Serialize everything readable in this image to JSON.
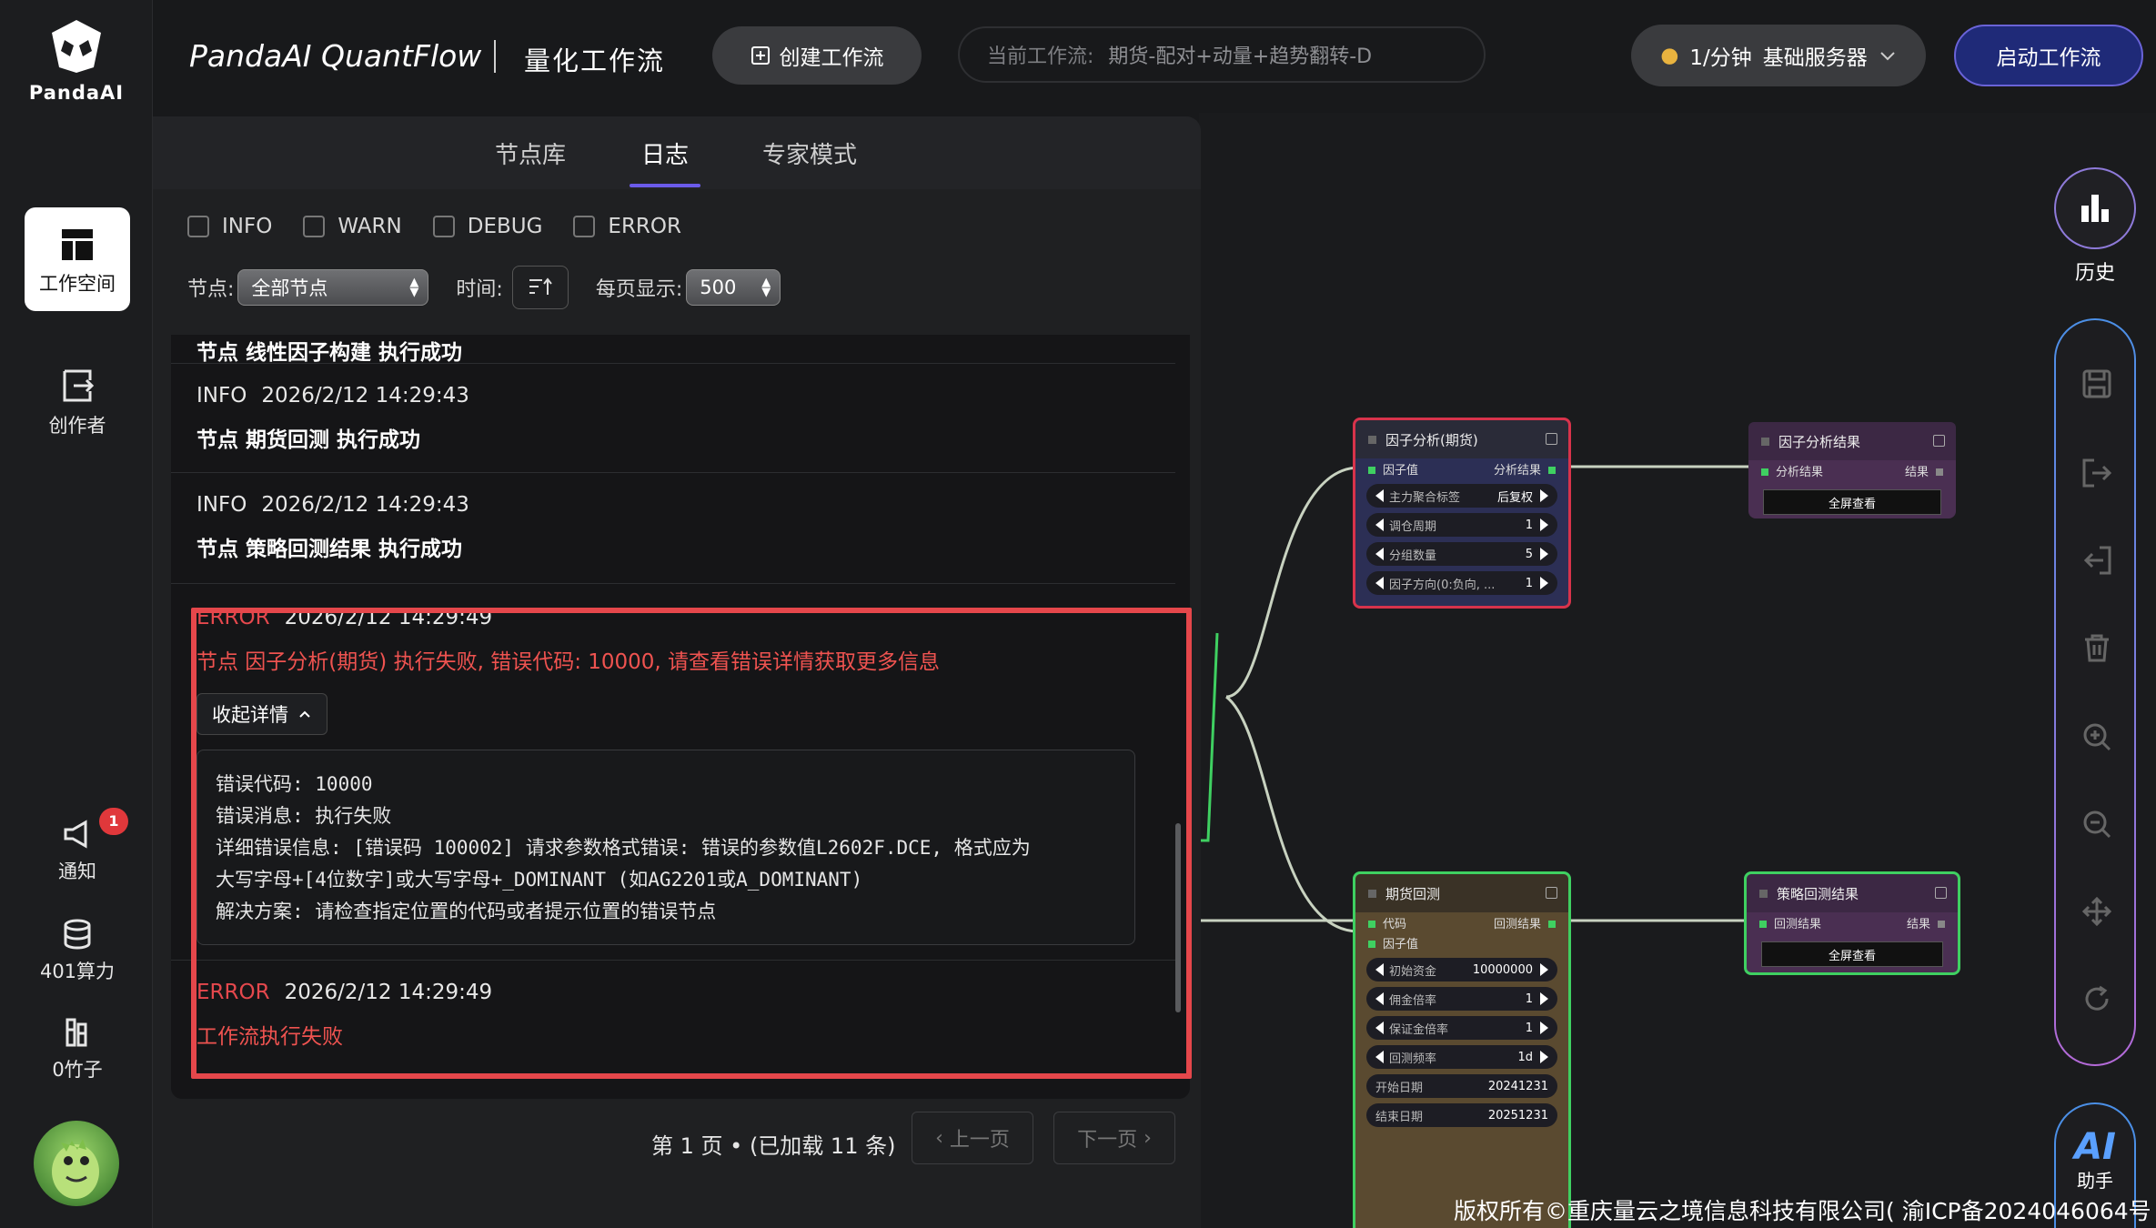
{
  "rail": {
    "logo_text": "PandaAI",
    "items": [
      {
        "label": "工作空间"
      },
      {
        "label": "创作者"
      }
    ],
    "notify": {
      "label": "通知",
      "badge": "1"
    },
    "compute": {
      "label": "401算力"
    },
    "bamboo": {
      "label": "0竹子"
    }
  },
  "header": {
    "brand": "PandaAI QuantFlow",
    "subtitle": "量化工作流",
    "create_btn": "创建工作流",
    "current_wf_label": "当前工作流:",
    "current_wf_value": "期货-配对+动量+趋势翻转-D",
    "server_rate": "1/分钟",
    "server_name": "基础服务器",
    "start_btn": "启动工作流"
  },
  "panel": {
    "tabs": [
      "节点库",
      "日志",
      "专家模式"
    ],
    "active_tab": 1,
    "filters": [
      "INFO",
      "WARN",
      "DEBUG",
      "ERROR"
    ],
    "node_label": "节点:",
    "node_select": "全部节点",
    "time_label": "时间:",
    "per_page_label": "每页显示:",
    "per_page_value": "500"
  },
  "logs": [
    {
      "msg": "节点 线性因子构建 执行成功"
    },
    {
      "level": "INFO",
      "time": "2026/2/12 14:29:43",
      "msg": "节点 期货回测 执行成功"
    },
    {
      "level": "INFO",
      "time": "2026/2/12 14:29:43",
      "msg": "节点 策略回测结果 执行成功"
    },
    {
      "level": "ERROR",
      "time": "2026/2/12 14:29:49",
      "msg": "节点 因子分析(期货) 执行失败, 错误代码: 10000, 请查看错误详情获取更多信息",
      "detail_btn": "收起详情",
      "details": [
        "错误代码: 10000",
        "错误消息: 执行失败",
        "详细错误信息: [错误码 100002] 请求参数格式错误: 错误的参数值L2602F.DCE, 格式应为",
        "大写字母+[4位数字]或大写字母+_DOMINANT (如AG2201或A_DOMINANT)",
        "解决方案: 请检查指定位置的代码或者提示位置的错误节点"
      ]
    },
    {
      "level": "ERROR",
      "time": "2026/2/12 14:29:49",
      "msg": "工作流执行失败"
    }
  ],
  "pager": {
    "text": "第 1 页 • (已加载 11 条)",
    "prev": "上一页",
    "next": "下一页"
  },
  "nodes": {
    "factor_analysis": {
      "title": "因子分析(期货)",
      "in": "因子值",
      "out": "分析结果",
      "params": [
        {
          "name": "主力聚合标签",
          "value": "后复权"
        },
        {
          "name": "调仓周期",
          "value": "1"
        },
        {
          "name": "分组数量",
          "value": "5"
        },
        {
          "name": "因子方向(0:负向, ...",
          "value": "1"
        }
      ]
    },
    "factor_result": {
      "title": "因子分析结果",
      "in": "分析结果",
      "out": "结果",
      "btn": "全屏查看"
    },
    "futures_backtest": {
      "title": "期货回测",
      "in1": "代码",
      "in2": "因子值",
      "out": "回测结果",
      "params": [
        {
          "name": "初始资金",
          "value": "10000000"
        },
        {
          "name": "佣金倍率",
          "value": "1"
        },
        {
          "name": "保证金倍率",
          "value": "1"
        },
        {
          "name": "回测频率",
          "value": "1d"
        },
        {
          "name": "开始日期",
          "value": "20241231"
        },
        {
          "name": "结束日期",
          "value": "20251231"
        }
      ]
    },
    "strategy_result": {
      "title": "策略回测结果",
      "in": "回测结果",
      "out": "结果",
      "btn": "全屏查看"
    }
  },
  "right_rail": {
    "history": "历史",
    "ai": "AI",
    "ai_label": "助手"
  },
  "footer": {
    "copyright": "版权所有©重庆量云之境信息科技有限公司( 渝ICP备2024046064号 )"
  },
  "colors": {
    "accent": "#6b5bea",
    "error": "#e5474b",
    "success": "#3fd061"
  }
}
